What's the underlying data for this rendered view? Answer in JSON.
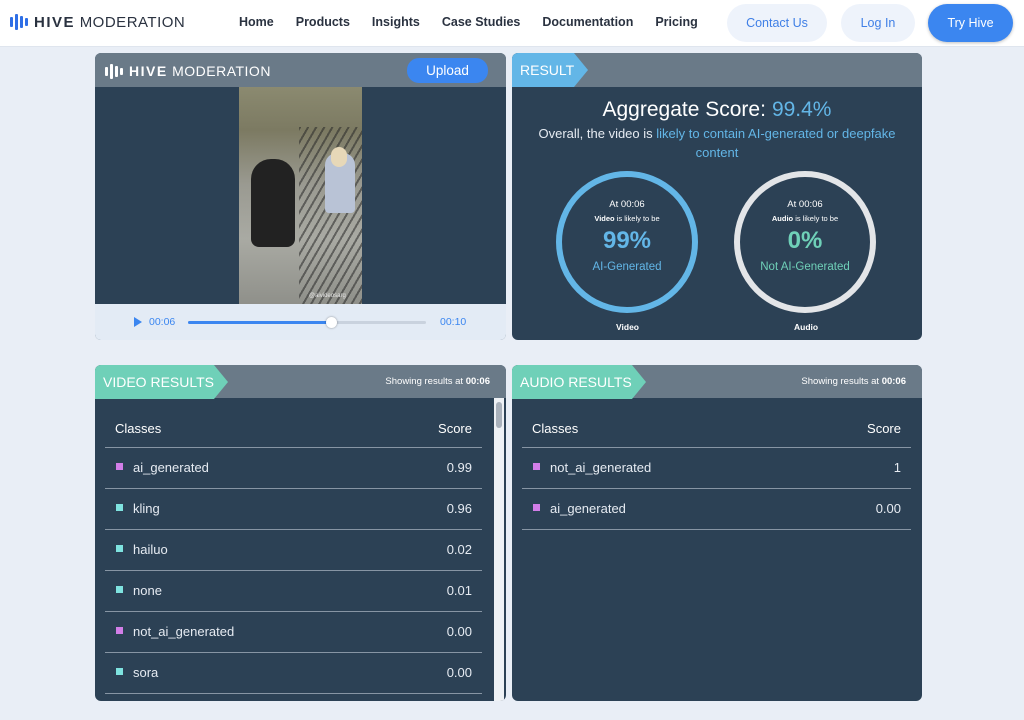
{
  "nav": {
    "logo_bold": "HIVE",
    "logo_light": "MODERATION",
    "links": [
      "Home",
      "Products",
      "Insights",
      "Case Studies",
      "Documentation",
      "Pricing"
    ],
    "contact": "Contact Us",
    "login": "Log In",
    "try": "Try Hive"
  },
  "player": {
    "logo_bold": "HIVE",
    "logo_light": "MODERATION",
    "upload": "Upload",
    "watermark": "@aivideosarg",
    "current_time": "00:06",
    "end_time": "00:10",
    "progress": 0.6
  },
  "result": {
    "tag": "RESULT",
    "aggregate_label": "Aggregate Score:",
    "aggregate_value": "99.4%",
    "overall_prefix": "Overall, the video is",
    "overall_highlight": "likely to contain AI-generated or deepfake content",
    "video": {
      "at": "At 00:06",
      "subject": "Video",
      "likely": "is likely to be",
      "pct": "99%",
      "label": "AI-Generated",
      "caption": "Video"
    },
    "audio": {
      "at": "At 00:06",
      "subject": "Audio",
      "likely": "is likely to be",
      "pct": "0%",
      "label": "Not AI-Generated",
      "caption": "Audio"
    }
  },
  "video_results": {
    "tag": "VIDEO RESULTS",
    "showing_prefix": "Showing results at",
    "showing_time": "00:06",
    "col_classes": "Classes",
    "col_score": "Score",
    "rows": [
      {
        "name": "ai_generated",
        "score": "0.99",
        "color": "#d27ee8"
      },
      {
        "name": "kling",
        "score": "0.96",
        "color": "#7fe3e0"
      },
      {
        "name": "hailuo",
        "score": "0.02",
        "color": "#7fe3e0"
      },
      {
        "name": "none",
        "score": "0.01",
        "color": "#7fe3e0"
      },
      {
        "name": "not_ai_generated",
        "score": "0.00",
        "color": "#d27ee8"
      },
      {
        "name": "sora",
        "score": "0.00",
        "color": "#7fe3e0"
      }
    ]
  },
  "audio_results": {
    "tag": "AUDIO RESULTS",
    "showing_prefix": "Showing results at",
    "showing_time": "00:06",
    "col_classes": "Classes",
    "col_score": "Score",
    "rows": [
      {
        "name": "not_ai_generated",
        "score": "1",
        "color": "#d27ee8"
      },
      {
        "name": "ai_generated",
        "score": "0.00",
        "color": "#d27ee8"
      }
    ]
  }
}
